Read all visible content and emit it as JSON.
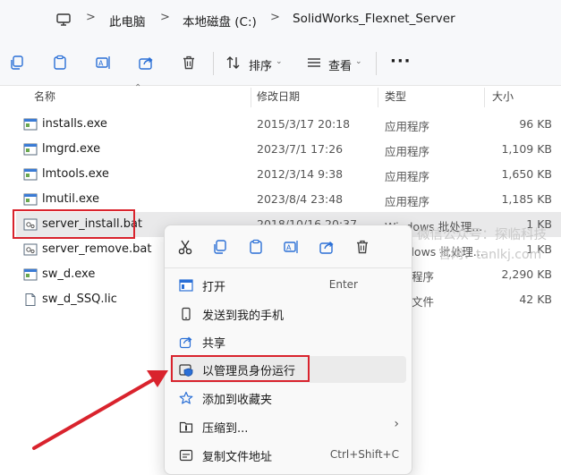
{
  "breadcrumb": {
    "items": [
      "此电脑",
      "本地磁盘 (C:)",
      "SolidWorks_Flexnet_Server"
    ],
    "separator": ">"
  },
  "toolbar": {
    "sort_label": "排序",
    "view_label": "查看",
    "more_label": "···"
  },
  "columns": {
    "name": "名称",
    "date": "修改日期",
    "type": "类型",
    "size": "大小"
  },
  "files": [
    {
      "name": "installs.exe",
      "date": "2015/3/17 20:18",
      "type": "应用程序",
      "size": "96 KB",
      "icon": "exe-icon"
    },
    {
      "name": "lmgrd.exe",
      "date": "2023/7/1 17:26",
      "type": "应用程序",
      "size": "1,109 KB",
      "icon": "exe-icon"
    },
    {
      "name": "lmtools.exe",
      "date": "2012/3/14 9:38",
      "type": "应用程序",
      "size": "1,650 KB",
      "icon": "exe-icon"
    },
    {
      "name": "lmutil.exe",
      "date": "2023/8/4 23:48",
      "type": "应用程序",
      "size": "1,185 KB",
      "icon": "exe-icon"
    },
    {
      "name": "server_install.bat",
      "date": "2018/10/16 20:37",
      "type": "Windows 批处理...",
      "size": "1 KB",
      "icon": "bat-icon"
    },
    {
      "name": "server_remove.bat",
      "date": "",
      "type": "dows 批处理...",
      "size": "1 KB",
      "icon": "bat-icon"
    },
    {
      "name": "sw_d.exe",
      "date": "",
      "type": "程序",
      "size": "2,290 KB",
      "icon": "exe-icon"
    },
    {
      "name": "sw_d_SSQ.lic",
      "date": "",
      "type": "文件",
      "size": "42 KB",
      "icon": "doc-icon"
    }
  ],
  "watermark": {
    "line1": "微信公众号：探临科技",
    "line2": "官网：tanlkj.com"
  },
  "context_menu": {
    "quick_actions": [
      "cut-icon",
      "copy-icon",
      "paste-icon",
      "rename-icon",
      "share-icon",
      "delete-icon"
    ],
    "items": [
      {
        "label": "打开",
        "shortcut": "Enter",
        "icon": "open-icon"
      },
      {
        "label": "发送到我的手机",
        "shortcut": "",
        "icon": "phone-icon"
      },
      {
        "label": "共享",
        "shortcut": "",
        "icon": "share-icon"
      },
      {
        "label": "以管理员身份运行",
        "shortcut": "",
        "icon": "admin-shield-icon"
      },
      {
        "label": "添加到收藏夹",
        "shortcut": "",
        "icon": "star-icon"
      },
      {
        "label": "压缩到...",
        "shortcut": "›",
        "icon": "zip-icon"
      },
      {
        "label": "复制文件地址",
        "shortcut": "Ctrl+Shift+C",
        "icon": "path-icon"
      }
    ]
  },
  "colors": {
    "highlight_red": "#d9232d",
    "accent_blue": "#2a6fd6",
    "selected_row": "#e9e9ea"
  }
}
